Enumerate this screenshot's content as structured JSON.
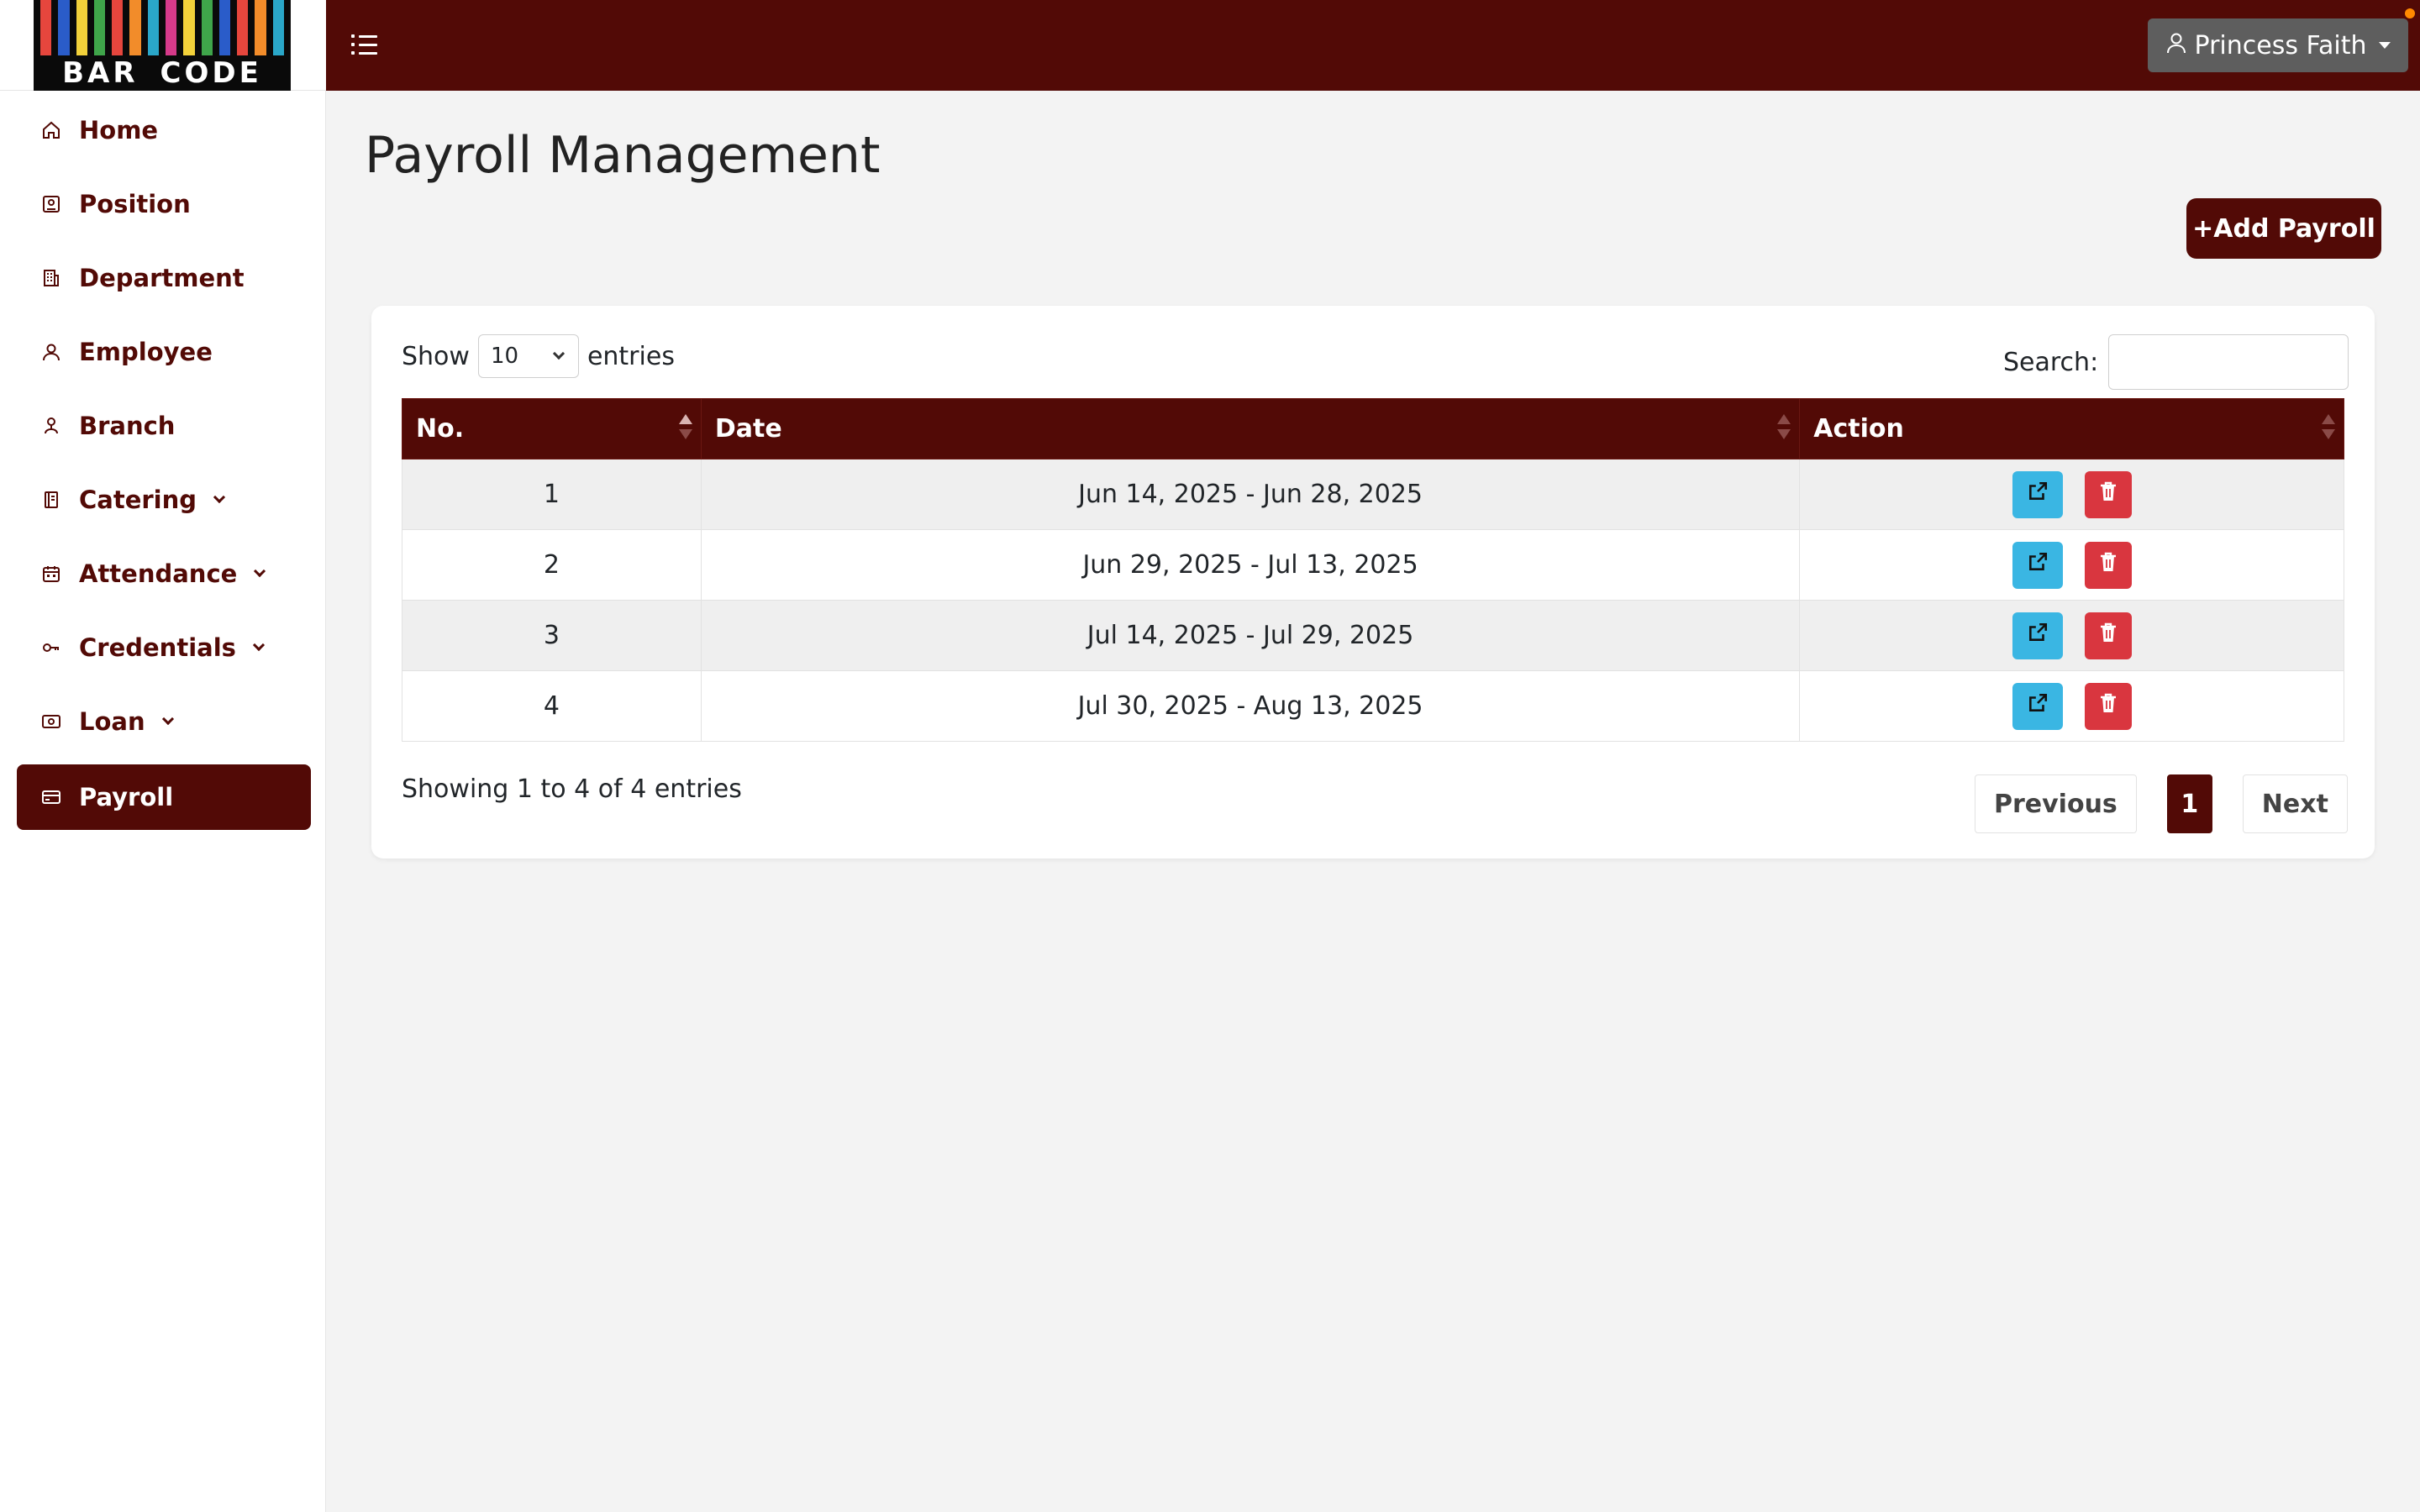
{
  "brand": {
    "logo_text": [
      "BAR",
      "CODE"
    ],
    "stripe_colors": [
      "#e6463d",
      "#2a5cc9",
      "#f2d13a",
      "#3fa54a",
      "#e6463d",
      "#f28c2a",
      "#2aa7c9",
      "#d63a8a",
      "#f2d13a",
      "#3fa54a",
      "#2a5cc9",
      "#e6463d",
      "#f28c2a",
      "#2aa7c9"
    ]
  },
  "header": {
    "user_name": "Princess Faith"
  },
  "sidebar": {
    "items": [
      {
        "label": "Home",
        "icon": "home-icon",
        "dropdown": false,
        "active": false
      },
      {
        "label": "Position",
        "icon": "badge-icon",
        "dropdown": false,
        "active": false
      },
      {
        "label": "Department",
        "icon": "building-icon",
        "dropdown": false,
        "active": false
      },
      {
        "label": "Employee",
        "icon": "person-icon",
        "dropdown": false,
        "active": false
      },
      {
        "label": "Branch",
        "icon": "branch-icon",
        "dropdown": false,
        "active": false
      },
      {
        "label": "Catering",
        "icon": "menu-book-icon",
        "dropdown": true,
        "active": false
      },
      {
        "label": "Attendance",
        "icon": "calendar-icon",
        "dropdown": true,
        "active": false
      },
      {
        "label": "Credentials",
        "icon": "key-icon",
        "dropdown": true,
        "active": false
      },
      {
        "label": "Loan",
        "icon": "cash-icon",
        "dropdown": true,
        "active": false
      },
      {
        "label": "Payroll",
        "icon": "card-icon",
        "dropdown": false,
        "active": true
      }
    ]
  },
  "main": {
    "title": "Payroll Management",
    "add_button": "+Add Payroll",
    "show_label": "Show",
    "entries_value": "10",
    "entries_label": "entries",
    "search_label": "Search:",
    "search_value": "",
    "columns": [
      "No.",
      "Date",
      "Action"
    ],
    "rows": [
      {
        "no": "1",
        "date": "Jun 14, 2025 - Jun 28, 2025"
      },
      {
        "no": "2",
        "date": "Jun 29, 2025 - Jul 13, 2025"
      },
      {
        "no": "3",
        "date": "Jul 14, 2025 - Jul 29, 2025"
      },
      {
        "no": "4",
        "date": "Jul 30, 2025 - Aug 13, 2025"
      }
    ],
    "info": "Showing 1 to 4 of 4 entries",
    "pagination": {
      "previous": "Previous",
      "current": "1",
      "next": "Next"
    }
  },
  "colors": {
    "primary": "#520a06",
    "view_button": "#3ab6e3",
    "delete_button": "#d9363f"
  }
}
